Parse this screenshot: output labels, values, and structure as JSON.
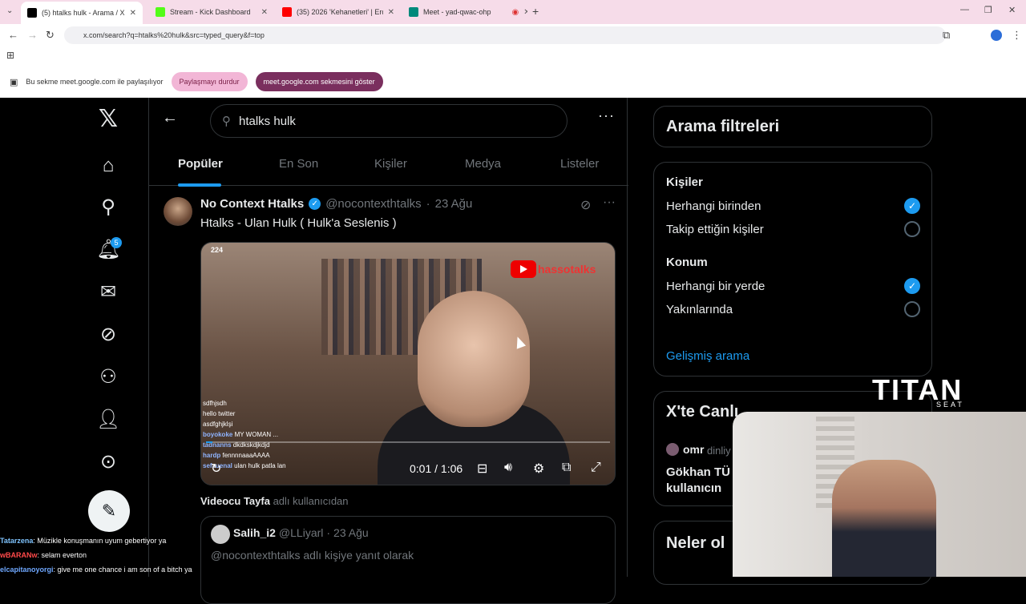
{
  "browser": {
    "tabs": [
      {
        "title": "(5) htalks hulk - Arama / X",
        "favicon_color": "#000000"
      },
      {
        "title": "Stream - Kick Dashboard",
        "favicon_color": "#53fc18"
      },
      {
        "title": "(35) 2026 'Kehanetleri' | Erdem A",
        "favicon_color": "#ff0000"
      },
      {
        "title": "Meet - yad-qwac-ohp",
        "favicon_color": "#00897b"
      }
    ],
    "url": "x.com/search?q=htalks%20hulk&src=typed_query&f=top"
  },
  "share_bar": {
    "message": "Bu sekme meet.google.com ile paylaşılıyor",
    "stop_label": "Paylaşmayı durdur",
    "show_label": "meet.google.com sekmesini göster"
  },
  "nav": {
    "notifications_count": "5"
  },
  "search": {
    "query": "htalks hulk",
    "tabs": [
      "Popüler",
      "En Son",
      "Kişiler",
      "Medya",
      "Listeler"
    ]
  },
  "tweet": {
    "name": "No Context Htalks",
    "handle": "@nocontexthtalks",
    "date": "23 Ağu",
    "text": "Htalks - Ulan Hulk ( Hulk'a Seslenis )",
    "video": {
      "views": "224",
      "channel": "hassotalks",
      "time": "0:01 / 1:06",
      "progress": 0.016,
      "chat": [
        {
          "user": "",
          "msg": "sdfhjsdh"
        },
        {
          "user": "",
          "msg": "hello twitter"
        },
        {
          "user": "",
          "msg": "asdfghjklşi"
        },
        {
          "user": "boyokoke",
          "msg": "MY WOMAN ..."
        },
        {
          "user": "tadnanns",
          "msg": "dkdkskdjkdjd"
        },
        {
          "user": "hardp",
          "msg": "fennnnaaaAAAA"
        },
        {
          "user": "sefauenal",
          "msg": "ulan hulk patla lan"
        }
      ]
    },
    "via_user": "Videocu Tayfa",
    "via_suffix": "adlı kullanıcıdan",
    "quote": {
      "name": "Salih_i2",
      "handle": "@LLiyarl",
      "date": "23 Ağu",
      "text": "@nocontexthtalks adlı kişiye yanıt olarak"
    }
  },
  "filters": {
    "title": "Arama filtreleri",
    "people_label": "Kişiler",
    "people_options": [
      "Herhangi birinden",
      "Takip ettiğin kişiler"
    ],
    "location_label": "Konum",
    "location_options": [
      "Herhangi bir yerde",
      "Yakınlarında"
    ],
    "advanced": "Gelişmiş arama"
  },
  "live": {
    "title": "X'te Canlı",
    "host": "omr",
    "host_suffix": "dinliy",
    "line1": "Gökhan TÜ",
    "line2": "kullanıcın"
  },
  "whats_happening": "Neler ol",
  "overlay": {
    "brand": "TITAN",
    "brand_sub": "SEAT",
    "stream_chat": [
      {
        "user": "Tatarzena",
        "msg": ": Müzikle konuşmanın uyum gebertiyor ya"
      },
      {
        "user": "wBARANw",
        "msg": ": selam everton"
      },
      {
        "user": "elcapitanoyorgi",
        "msg": ": give me one chance i am son of a bitch ya"
      }
    ]
  }
}
